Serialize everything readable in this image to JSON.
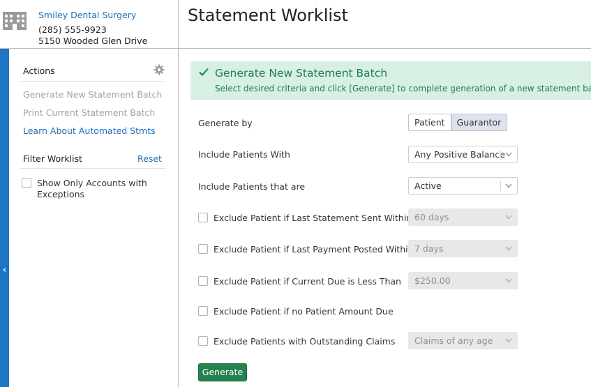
{
  "practice": {
    "name": "Smiley Dental Surgery",
    "phone": "(285) 555-9923",
    "address": "5150 Wooded Glen Drive"
  },
  "page_title": "Statement Worklist",
  "sidebar": {
    "actions_heading": "Actions",
    "actions": [
      {
        "label": "Generate New Statement Batch",
        "state": "disabled"
      },
      {
        "label": "Print Current Statement Batch",
        "state": "disabled"
      },
      {
        "label": "Learn About Automated Stmts",
        "state": "link"
      }
    ],
    "filter_heading": "Filter Worklist",
    "reset_label": "Reset",
    "filter_checkbox_label": "Show Only Accounts with Exceptions"
  },
  "banner": {
    "title": "Generate New Statement Batch",
    "subtitle": "Select desired criteria and click [Generate] to complete generation of a new statement batch"
  },
  "form": {
    "generate_by": {
      "label": "Generate by",
      "options": [
        "Patient",
        "Guarantor"
      ],
      "selected": "Guarantor"
    },
    "include_with": {
      "label": "Include Patients With",
      "value": "Any Positive Balance"
    },
    "include_that_are": {
      "label": "Include Patients that are",
      "value": "Active"
    },
    "exclusions": [
      {
        "label": "Exclude Patient if Last Statement Sent Within",
        "value": "60 days",
        "checked": false
      },
      {
        "label": "Exclude Patient if Last Payment Posted Within",
        "value": "7 days",
        "checked": false
      },
      {
        "label": "Exclude Patient if Current Due is Less Than",
        "value": "$250.00",
        "checked": false
      },
      {
        "label": "Exclude Patient if no Patient Amount Due",
        "checked": false
      },
      {
        "label": "Exclude Patients with Outstanding Claims",
        "value": "Claims of any age",
        "checked": false
      }
    ],
    "generate_label": "Generate"
  },
  "colors": {
    "accent_blue": "#1d75c4",
    "link_blue": "#1d6fb8",
    "success_green": "#23834f",
    "banner_bg": "#d8efe4"
  },
  "icons": {
    "practice": "building-icon",
    "settings": "gear-icon",
    "banner": "check-icon",
    "rail": "chevron-left-icon",
    "select": "chevron-down-icon"
  }
}
